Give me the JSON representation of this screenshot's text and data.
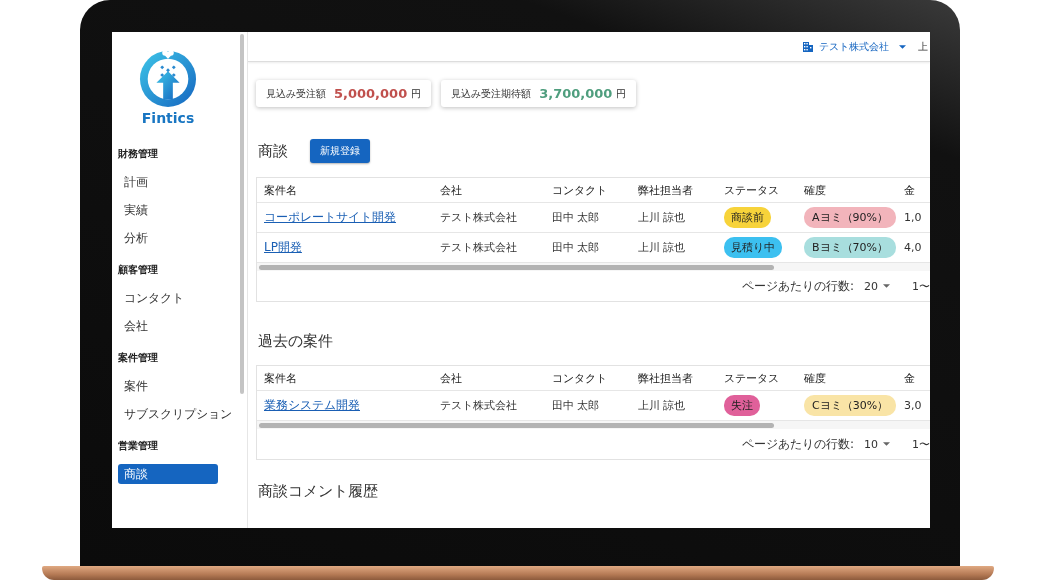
{
  "sidebar": {
    "logo_text": "Fintics",
    "groups": [
      {
        "heading": "財務管理",
        "items": [
          {
            "label": "計画",
            "selected": false
          },
          {
            "label": "実績",
            "selected": false
          },
          {
            "label": "分析",
            "selected": false
          }
        ]
      },
      {
        "heading": "顧客管理",
        "items": [
          {
            "label": "コンタクト",
            "selected": false
          },
          {
            "label": "会社",
            "selected": false
          }
        ]
      },
      {
        "heading": "案件管理",
        "items": [
          {
            "label": "案件",
            "selected": false
          },
          {
            "label": "サブスクリプション",
            "selected": false
          }
        ]
      },
      {
        "heading": "営業管理",
        "items": [
          {
            "label": "商談",
            "selected": true
          }
        ]
      }
    ]
  },
  "header": {
    "company": "テスト株式会社",
    "user": "上"
  },
  "summary_cards": [
    {
      "label": "見込み受注額",
      "amount": "5,000,000",
      "unit": "円",
      "color": "#c0504d"
    },
    {
      "label": "見込み受注期待額",
      "amount": "3,700,000",
      "unit": "円",
      "color": "#4f9e7e"
    }
  ],
  "deals": {
    "title": "商談",
    "new_button": "新規登録",
    "columns": [
      "案件名",
      "会社",
      "コンタクト",
      "弊社担当者",
      "ステータス",
      "確度",
      "金"
    ],
    "rows": [
      {
        "name": "コーポレートサイト開発",
        "company": "テスト株式会社",
        "contact": "田中 太郎",
        "owner": "上川 諒也",
        "status": {
          "text": "商談前",
          "color": "#f7d33a"
        },
        "confidence": {
          "text": "Aヨミ（90%）",
          "color": "#f2b4bb"
        },
        "amount": "1,0"
      },
      {
        "name": "LP開発",
        "company": "テスト株式会社",
        "contact": "田中 太郎",
        "owner": "上川 諒也",
        "status": {
          "text": "見積り中",
          "color": "#3cc0f0"
        },
        "confidence": {
          "text": "Bヨミ（70%）",
          "color": "#a8dede"
        },
        "amount": "4,0"
      }
    ],
    "pagination": {
      "label": "ページあたりの行数:",
      "per_page": "20",
      "range": "1〜"
    }
  },
  "past": {
    "title": "過去の案件",
    "columns": [
      "案件名",
      "会社",
      "コンタクト",
      "弊社担当者",
      "ステータス",
      "確度",
      "金"
    ],
    "rows": [
      {
        "name": "業務システム開発",
        "company": "テスト株式会社",
        "contact": "田中 太郎",
        "owner": "上川 諒也",
        "status": {
          "text": "失注",
          "color": "#e0609a"
        },
        "confidence": {
          "text": "Cヨミ（30%）",
          "color": "#f9e4a6"
        },
        "amount": "3,0"
      }
    ],
    "pagination": {
      "label": "ページあたりの行数:",
      "per_page": "10",
      "range": "1〜"
    }
  },
  "comments": {
    "title": "商談コメント履歴"
  }
}
